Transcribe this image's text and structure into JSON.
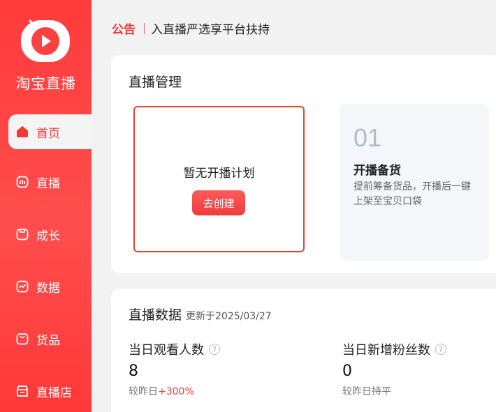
{
  "brand": {
    "name": "淘宝直播",
    "logo_icon": "taobao-live-logo"
  },
  "sidebar": {
    "items": [
      {
        "label": "首页",
        "icon": "home-icon",
        "active": true
      },
      {
        "label": "直播",
        "icon": "live-icon",
        "active": false
      },
      {
        "label": "成长",
        "icon": "growth-icon",
        "active": false
      },
      {
        "label": "数据",
        "icon": "data-chart-icon",
        "active": false
      },
      {
        "label": "货品",
        "icon": "goods-icon",
        "active": false
      },
      {
        "label": "直播店",
        "icon": "store-icon",
        "active": false
      }
    ]
  },
  "notice": {
    "tag": "公告",
    "message": "入直播严选享平台扶持"
  },
  "live_management": {
    "title": "直播管理",
    "empty_text": "暂无开播计划",
    "create_button": "去创建",
    "step": {
      "number": "01",
      "title": "开播备货",
      "description": "提前筹备货品，开播后一键上架至宝贝口袋"
    }
  },
  "live_data": {
    "title": "直播数据",
    "updated": "更新于2025/03/27",
    "metrics": [
      {
        "label": "当日观看人数",
        "value": "8",
        "change_prefix": "较昨日",
        "change_value": "+300%"
      },
      {
        "label": "当日新增粉丝数",
        "value": "0",
        "change_prefix": "较昨日持平",
        "change_value": ""
      }
    ]
  },
  "colors": {
    "accent": "#f33a35",
    "sidebar": "#ff4040"
  }
}
